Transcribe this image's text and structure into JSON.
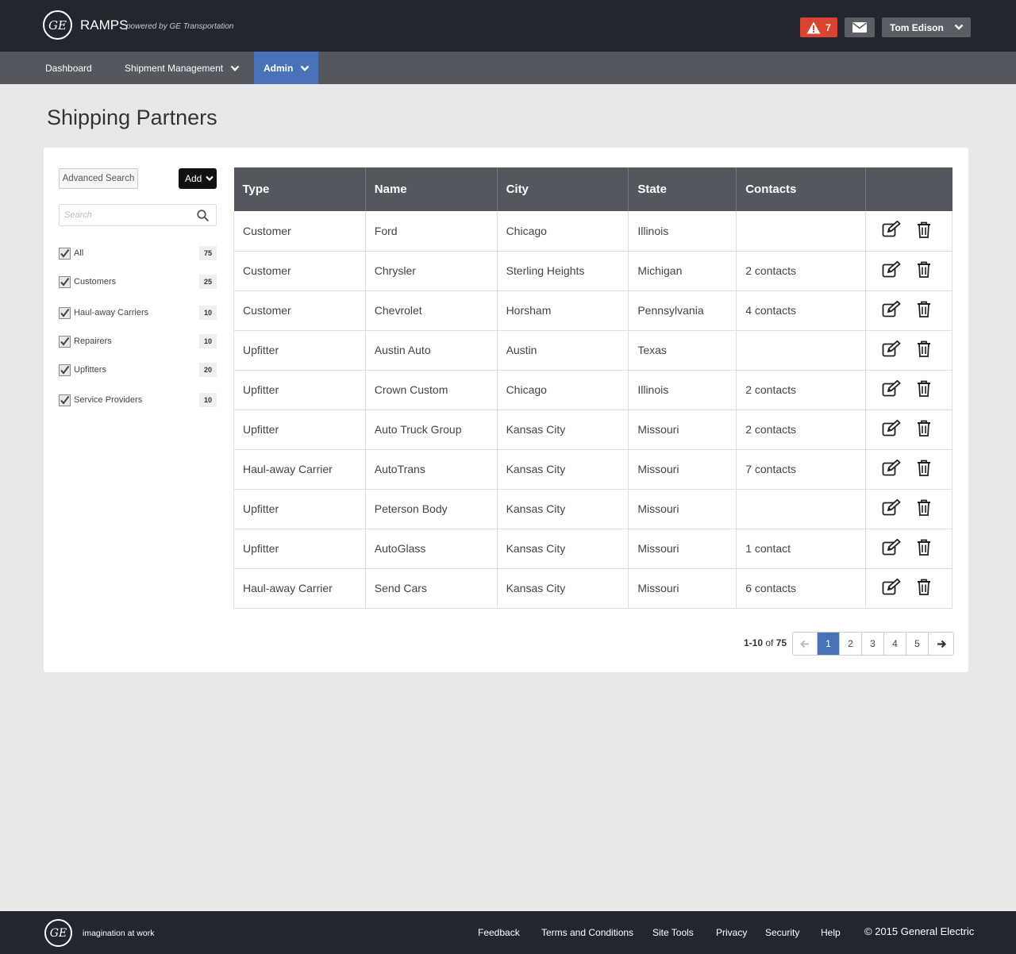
{
  "header": {
    "logo_text": "GE",
    "app_name": "RAMPS",
    "powered_by": "powered by GE Transportation",
    "alert_count": "7",
    "user_name": "Tom Edison"
  },
  "nav": {
    "dashboard": "Dashboard",
    "shipment_management": "Shipment Management",
    "admin": "Admin"
  },
  "page": {
    "title": "Shipping Partners"
  },
  "sidebar": {
    "advanced_search": "Advanced Search",
    "add": "Add",
    "search_placeholder": "Search",
    "filters": [
      {
        "label": "All",
        "count": "75",
        "checked": true
      },
      {
        "label": "Customers",
        "count": "25",
        "checked": true
      },
      {
        "label": "Haul-away Carriers",
        "count": "10",
        "checked": true
      },
      {
        "label": "Repairers",
        "count": "10",
        "checked": true
      },
      {
        "label": "Upfitters",
        "count": "20",
        "checked": true
      },
      {
        "label": "Service Providers",
        "count": "10",
        "checked": true
      }
    ]
  },
  "table": {
    "columns": [
      "Type",
      "Name",
      "City",
      "State",
      "Contacts",
      ""
    ],
    "rows": [
      [
        "Customer",
        "Ford",
        "Chicago",
        "Illinois",
        ""
      ],
      [
        "Customer",
        "Chrysler",
        "Sterling Heights",
        "Michigan",
        "2 contacts"
      ],
      [
        "Customer",
        "Chevrolet",
        "Horsham",
        "Pennsylvania",
        "4 contacts"
      ],
      [
        "Upfitter",
        "Austin Auto",
        "Austin",
        "Texas",
        ""
      ],
      [
        "Upfitter",
        "Crown Custom",
        "Chicago",
        "Illinois",
        "2 contacts"
      ],
      [
        "Upfitter",
        "Auto Truck Group",
        "Kansas City",
        "Missouri",
        "2 contacts"
      ],
      [
        "Haul-away Carrier",
        "AutoTrans",
        "Kansas City",
        "Missouri",
        "7 contacts"
      ],
      [
        "Upfitter",
        "Peterson Body",
        "Kansas City",
        "Missouri",
        ""
      ],
      [
        "Upfitter",
        "AutoGlass",
        "Kansas City",
        "Missouri",
        "1 contact"
      ],
      [
        "Haul-away Carrier",
        "Send Cars",
        "Kansas City",
        "Missouri",
        "6 contacts"
      ]
    ]
  },
  "pagination": {
    "range": "1-10",
    "of_label": "of",
    "total": "75",
    "pages": [
      "1",
      "2",
      "3",
      "4",
      "5"
    ],
    "current": "1"
  },
  "footer": {
    "logo_text": "GE",
    "tagline": "imagination at work",
    "links": [
      "Feedback",
      "Terms and Conditions",
      "Site Tools",
      "Privacy",
      "Security",
      "Help"
    ],
    "copyright": "© 2015 General Electric"
  },
  "colors": {
    "header_bg": "#23262e",
    "nav_bg": "#54575e",
    "accent": "#4a72b8",
    "alert": "#d9432f"
  }
}
